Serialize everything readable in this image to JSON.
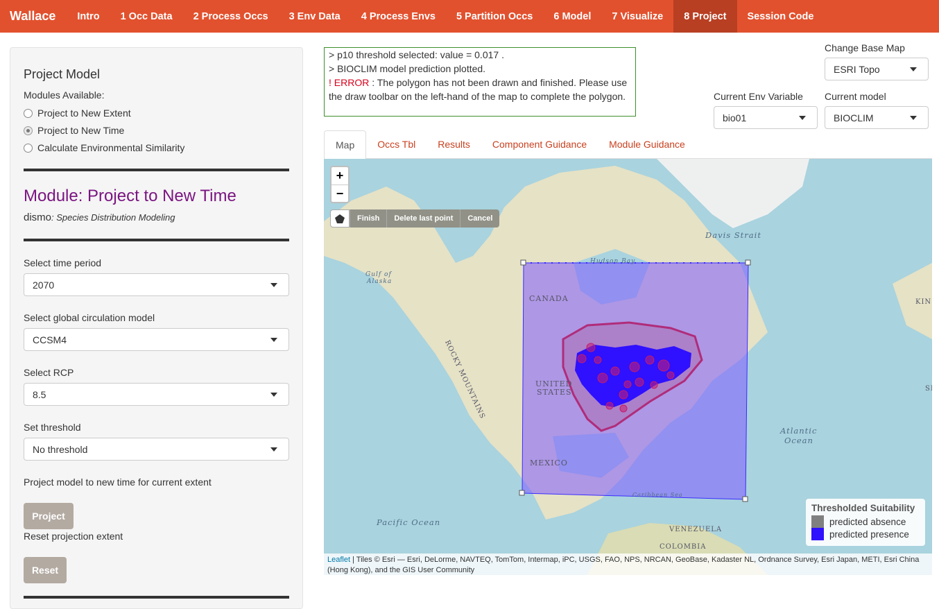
{
  "navbar": {
    "brand": "Wallace",
    "items": [
      "Intro",
      "1 Occ Data",
      "2 Process Occs",
      "3 Env Data",
      "4 Process Envs",
      "5 Partition Occs",
      "6 Model",
      "7 Visualize",
      "8 Project",
      "Session Code"
    ],
    "active": "8 Project"
  },
  "sidebar": {
    "title": "Project Model",
    "modules_label": "Modules Available:",
    "modules": [
      {
        "label": "Project to New Extent",
        "checked": false
      },
      {
        "label": "Project to New Time",
        "checked": true
      },
      {
        "label": "Calculate Environmental Similarity",
        "checked": false
      }
    ],
    "module_title": "Module: Project to New Time",
    "module_pkg": "dismo",
    "module_pkg_desc": ": Species Distribution Modeling",
    "time_label": "Select time period",
    "time_value": "2070",
    "gcm_label": "Select global circulation model",
    "gcm_value": "CCSM4",
    "rcp_label": "Select RCP",
    "rcp_value": "8.5",
    "threshold_label": "Set threshold",
    "threshold_value": "No threshold",
    "project_text": "Project model to new time for current extent",
    "project_button": "Project",
    "reset_text": "Reset projection extent",
    "reset_button": "Reset"
  },
  "log": {
    "line1": "> p10 threshold selected: value = 0.017 .",
    "line2": "> BIOCLIM model prediction plotted.",
    "error_tag": "! ERROR",
    "error_text": " : The polygon has not been drawn and finished. Please use the draw toolbar on the left-hand of the map to complete the polygon."
  },
  "controls": {
    "basemap_label": "Change Base Map",
    "basemap_value": "ESRI Topo",
    "env_label": "Current Env Variable",
    "env_value": "bio01",
    "model_label": "Current model",
    "model_value": "BIOCLIM"
  },
  "tabs": [
    "Map",
    "Occs Tbl",
    "Results",
    "Component Guidance",
    "Module Guidance"
  ],
  "active_tab": "Map",
  "map": {
    "zoom_in": "+",
    "zoom_out": "−",
    "draw_actions": [
      "Finish",
      "Delete last point",
      "Cancel"
    ],
    "labels": {
      "davis": "Davis Strait",
      "hudson": "Hudson Bay",
      "gulf": "Gulf of",
      "alaska": "Alaska",
      "canada": "CANADA",
      "rocky": "ROCKY MOUNTAINS",
      "united": "UNITED",
      "states": "STATES",
      "mexico": "MEXICO",
      "atlantic": "Atlantic",
      "ocean": "Ocean",
      "pacific": "Pacific Ocean",
      "caribbean": "Caribbean Sea",
      "venezuela": "VENEZUELA",
      "colombia": "COLOMBIA",
      "kin": "KIN",
      "sp": "SP"
    },
    "legend_title": "Thresholded Suitability",
    "legend_items": [
      {
        "label": "predicted absence",
        "color": "#808080"
      },
      {
        "label": "predicted presence",
        "color": "#2f10ff"
      }
    ],
    "attrib_link": "Leaflet",
    "attrib_text": " | Tiles © Esri — Esri, DeLorme, NAVTEQ, TomTom, Intermap, iPC, USGS, FAO, NPS, NRCAN, GeoBase, Kadaster NL, Ordnance Survey, Esri Japan, METI, Esri China (Hong Kong), and the GIS User Community"
  },
  "colors": {
    "navbar": "#e2512e",
    "navbar_active": "#b83f22",
    "module_title": "#7b1582",
    "tab_link": "#c9401f",
    "error": "#d9001b"
  }
}
